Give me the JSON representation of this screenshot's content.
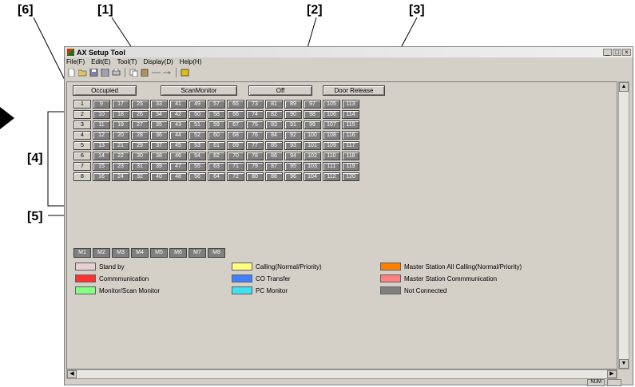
{
  "callouts": {
    "c6": "[6]",
    "c1": "[1]",
    "c2": "[2]",
    "c3": "[3]",
    "c4": "[4]",
    "c5": "[5]"
  },
  "window": {
    "title": "AX Setup Tool",
    "controls": {
      "minimize": "_",
      "maximize": "□",
      "close": "×"
    }
  },
  "menu": [
    "File(F)",
    "Edit(E)",
    "Tool(T)",
    "Display(D)",
    "Help(H)"
  ],
  "toolbar_icons": [
    "new-file-icon",
    "open-folder-icon",
    "save-icon",
    "save-all-icon",
    "print-icon",
    "copy-icon",
    "paste-icon",
    "line-icon",
    "arrow-icon",
    "download-icon"
  ],
  "buttons": {
    "occupied": "Occupied",
    "scan_monitor": "ScanMonitor",
    "off": "Off",
    "door_release": "Door Release"
  },
  "grid": {
    "rows": [
      [
        "1",
        "9",
        "17",
        "25",
        "33",
        "41",
        "49",
        "57",
        "65",
        "73",
        "81",
        "89",
        "97",
        "105",
        "113"
      ],
      [
        "2",
        "10",
        "18",
        "26",
        "34",
        "42",
        "50",
        "58",
        "66",
        "74",
        "82",
        "90",
        "98",
        "106",
        "114"
      ],
      [
        "3",
        "11",
        "19",
        "27",
        "35",
        "43",
        "51",
        "59",
        "67",
        "75",
        "83",
        "91",
        "99",
        "107",
        "115"
      ],
      [
        "4",
        "12",
        "20",
        "28",
        "36",
        "44",
        "52",
        "60",
        "68",
        "76",
        "84",
        "92",
        "100",
        "108",
        "116"
      ],
      [
        "5",
        "13",
        "21",
        "29",
        "37",
        "45",
        "53",
        "61",
        "69",
        "77",
        "85",
        "93",
        "101",
        "109",
        "117"
      ],
      [
        "6",
        "14",
        "22",
        "30",
        "38",
        "46",
        "54",
        "62",
        "70",
        "78",
        "86",
        "94",
        "102",
        "110",
        "118"
      ],
      [
        "7",
        "15",
        "23",
        "31",
        "39",
        "47",
        "55",
        "63",
        "71",
        "79",
        "87",
        "95",
        "103",
        "111",
        "119"
      ],
      [
        "8",
        "16",
        "24",
        "32",
        "40",
        "48",
        "56",
        "64",
        "72",
        "80",
        "88",
        "96",
        "104",
        "112",
        "120"
      ]
    ]
  },
  "masters": [
    "M1",
    "M2",
    "M3",
    "M4",
    "M5",
    "M6",
    "M7",
    "M8"
  ],
  "legend": [
    {
      "label": "Stand by",
      "color": "#e8d0d0"
    },
    {
      "label": "Calling(Normal/Priority)",
      "color": "#ffff80"
    },
    {
      "label": "Master Station All Calling(Normal/Priority)",
      "color": "#ff8000"
    },
    {
      "label": "Commmunication",
      "color": "#ff3030"
    },
    {
      "label": "CO Transfer",
      "color": "#4080ff"
    },
    {
      "label": "Master Station Commmunication",
      "color": "#ff8080"
    },
    {
      "label": "Monitor/Scan Monitor",
      "color": "#80ff80"
    },
    {
      "label": "PC Monitor",
      "color": "#40e0f0"
    },
    {
      "label": "Not Connected",
      "color": "#7f7f7f"
    }
  ],
  "status": {
    "num": "NUM"
  },
  "colors": {
    "not_connected": "#7f7f7f",
    "window_bg": "#d4d0c8"
  }
}
